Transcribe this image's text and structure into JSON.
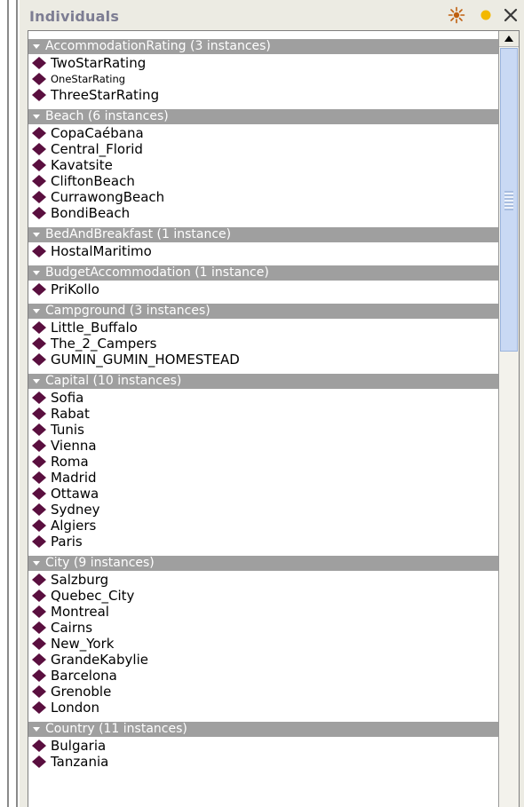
{
  "panel": {
    "title": "Individuals",
    "colors": {
      "header_bg": "#ecebe3",
      "group_bar": "#9f9f9f",
      "diamond": "#5a0f3f",
      "sun_icon": "#c06010",
      "dot_icon": "#f3b800",
      "close_icon": "#3a3a3a"
    },
    "icons": {
      "add": "asterisk-sun-icon",
      "delete": "orange-dot-icon",
      "close": "x-close-icon"
    }
  },
  "groups": [
    {
      "label": "AccommodationRating (3 instances)",
      "items": [
        "TwoStarRating",
        "OneStarRating",
        "ThreeStarRating"
      ]
    },
    {
      "label": "Beach (6 instances)",
      "items": [
        "CopaCaébana",
        "Central_Florid",
        "Kavatsite",
        "CliftonBeach",
        "CurrawongBeach",
        "BondiBeach"
      ]
    },
    {
      "label": "BedAndBreakfast (1 instance)",
      "items": [
        "HostalMaritimo"
      ]
    },
    {
      "label": "BudgetAccommodation (1 instance)",
      "items": [
        "PriKollo"
      ]
    },
    {
      "label": "Campground (3 instances)",
      "items": [
        "Little_Buffalo",
        "The_2_Campers",
        "GUMIN_GUMIN_HOMESTEAD"
      ]
    },
    {
      "label": "Capital (10 instances)",
      "items": [
        "Sofia",
        "Rabat",
        "Tunis",
        "Vienna",
        "Roma",
        "Madrid",
        "Ottawa",
        "Sydney",
        "Algiers",
        "Paris"
      ]
    },
    {
      "label": "City (9 instances)",
      "items": [
        "Salzburg",
        "Quebec_City",
        "Montreal",
        "Cairns",
        "New_York",
        "GrandeKabylie",
        "Barcelona",
        "Grenoble",
        "London"
      ]
    },
    {
      "label": "Country (11 instances)",
      "items": [
        "Bulgaria",
        "Tanzania"
      ]
    }
  ]
}
